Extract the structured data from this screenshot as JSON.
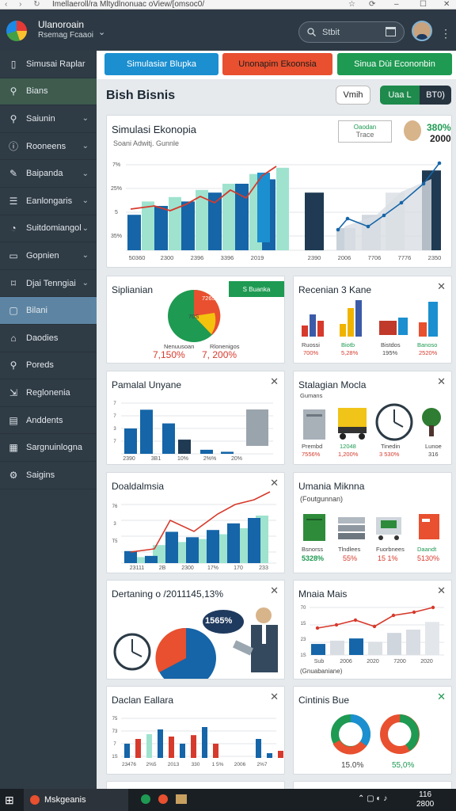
{
  "browser": {
    "url": "Imellaeroll/ra Mltydlnonuac oView/[omsoc0/",
    "nav": "‹ › ↻"
  },
  "app": {
    "name": "Ulanoroain",
    "subtitle": "Rsemag Fcaaoi"
  },
  "search": {
    "placeholder": "Stbit"
  },
  "sidebar": {
    "items": [
      {
        "label": "Simusai Raplar",
        "icon": "book-icon",
        "chev": false,
        "state": ""
      },
      {
        "label": "Bians",
        "icon": "search-icon",
        "chev": false,
        "state": "green"
      },
      {
        "label": "Saiunin",
        "icon": "search-icon",
        "chev": true,
        "state": ""
      },
      {
        "label": "Rooneens",
        "icon": "info-icon",
        "chev": true,
        "state": ""
      },
      {
        "label": "Baipanda",
        "icon": "edit-icon",
        "chev": true,
        "state": ""
      },
      {
        "label": "Eanlongaris",
        "icon": "list-icon",
        "chev": true,
        "state": ""
      },
      {
        "label": "Suitdomiangol",
        "icon": "gauge-icon",
        "chev": true,
        "state": ""
      },
      {
        "label": "Gopnien",
        "icon": "window-icon",
        "chev": true,
        "state": ""
      },
      {
        "label": "Djai Tenngiai",
        "icon": "tag-icon",
        "chev": true,
        "state": ""
      },
      {
        "label": "Bilani",
        "icon": "chat-icon",
        "chev": false,
        "state": "active"
      },
      {
        "label": "Daodies",
        "icon": "home-icon",
        "chev": false,
        "state": ""
      },
      {
        "label": "Poreds",
        "icon": "search-icon",
        "chev": false,
        "state": ""
      },
      {
        "label": "Reglonenia",
        "icon": "export-icon",
        "chev": false,
        "state": ""
      },
      {
        "label": "Anddents",
        "icon": "doc-icon",
        "chev": false,
        "state": ""
      },
      {
        "label": "Sargnuinlogna",
        "icon": "calendar-icon",
        "chev": false,
        "state": ""
      },
      {
        "label": "Saigins",
        "icon": "gear-icon",
        "chev": false,
        "state": ""
      }
    ]
  },
  "tabs": [
    {
      "label": "Simulasiar Blupka",
      "color": "#1b8fd0"
    },
    {
      "label": "Unonapim Ekoonsia",
      "color": "#e8502f"
    },
    {
      "label": "Sinua Dùi Econonbin",
      "color": "#1e9a52"
    }
  ],
  "page": {
    "title": "Bish Bisnis",
    "view_btn": "Vmih",
    "seg_a": "Uaa L",
    "seg_b": "BT0)"
  },
  "hero": {
    "title": "Simulasi Ekonopia",
    "subtitle": "Soani Adwitj. Gunnle",
    "badge_line1": "Oaodan",
    "badge_line2": "Trace",
    "stat_top": "380%",
    "stat_bottom": "2000",
    "x_left": [
      "50360",
      "2300",
      "2396",
      "3396",
      "2019"
    ],
    "x_right": [
      "2390",
      "2006",
      "7706",
      "7776",
      "2350"
    ],
    "y_ticks": [
      "7%",
      "25%",
      "5",
      "35%"
    ]
  },
  "cards": {
    "c1": {
      "title": "Siplianian",
      "badge": "S Buanka",
      "pie_top": "7265",
      "pie_mid": "70S",
      "l1": "Nenuusoan",
      "l2": "Rlonenigos",
      "v1": "7,150%",
      "v2": "7, 200%"
    },
    "c2": {
      "title": "Recenian 3 Kane",
      "items": [
        {
          "n": "Ruossi",
          "p": "700%"
        },
        {
          "n": "Biotb",
          "p": "5,28%"
        },
        {
          "n": "Bistdos",
          "p": "195%"
        },
        {
          "n": "Banoso",
          "p": "2520%"
        }
      ]
    },
    "c3": {
      "title": "Pamalal Unyane",
      "x": [
        "2390",
        "3B1",
        "10%",
        "2%%",
        "20%"
      ]
    },
    "c4": {
      "title": "Stalagian Mocla",
      "sub": "Gumans",
      "items": [
        {
          "n": "Prembd",
          "p": "7556%"
        },
        {
          "n": "12048",
          "p": "1,200%"
        },
        {
          "n": "Tinedin",
          "p": "3 530%"
        },
        {
          "n": "Lunoe",
          "p": "316"
        }
      ]
    },
    "c5": {
      "title": "Doaldalmsia",
      "x": [
        "23111",
        "2B",
        "2300",
        "17%",
        "170",
        "233"
      ]
    },
    "c6": {
      "title": "Umania Miknna",
      "sub": "(Foutgunnan)",
      "items": [
        {
          "n": "Bsnorss",
          "p": "5328%"
        },
        {
          "n": "Tlndlees",
          "p": "55%"
        },
        {
          "n": "Fuorbnees",
          "p": "15 1%"
        },
        {
          "n": "Daandt",
          "p": "5130%"
        }
      ]
    },
    "c7": {
      "title": "Dertaning o /2011145,13%",
      "bubble": "1565%"
    },
    "c8": {
      "title": "Mnaia Mais",
      "x": [
        "Sub",
        "2006",
        "2020",
        "7200",
        "2020"
      ],
      "y": [
        "70",
        "15",
        "23",
        "1S"
      ],
      "foot": "(Gnuabaniane)"
    },
    "c9": {
      "title": "Daclan Eallara",
      "x": [
        "23476",
        "2%5",
        "2013",
        "330",
        "1 5%",
        "2006",
        "2%7"
      ]
    },
    "c10": {
      "title": "Cintinis Bue",
      "v1": "15.0%",
      "v2": "55,0%"
    }
  },
  "taskbar": {
    "label": "Mskgeanis",
    "time": "116",
    "date": "2800"
  },
  "chart_data": [
    {
      "type": "bar",
      "title": "Simulasi Ekonopia",
      "categories": [
        "50360",
        "2300",
        "2396",
        "3396",
        "2019"
      ],
      "series": [
        {
          "values": [
            4,
            5,
            5.5,
            6.5,
            7.5,
            8
          ]
        },
        {
          "values": [
            5.5,
            6,
            6.8,
            7.5,
            8.6,
            9.3
          ]
        }
      ]
    },
    {
      "type": "bar",
      "categories": [
        "2390",
        "2006",
        "7706",
        "7776",
        "2350"
      ],
      "series": [
        {
          "values": [
            6.5,
            2.5,
            4,
            6.5,
            9
          ]
        }
      ]
    },
    {
      "type": "bar",
      "title": "Pamalal Unyane",
      "categories": [
        "2390",
        "3B1",
        "10%",
        "2%%",
        "20%"
      ],
      "series": [
        {
          "values": [
            5,
            8.7,
            6,
            2.8,
            0.8,
            0.4
          ]
        }
      ]
    },
    {
      "type": "bar",
      "title": "Doaldalmsia",
      "categories": [
        "23111",
        "2B",
        "2300",
        "17%",
        "170",
        "233"
      ],
      "series": [
        {
          "values": [
            2,
            1.2,
            5.2,
            4.3,
            5.5,
            6.6,
            7.5
          ]
        },
        {
          "values": [
            1,
            3,
            3.5,
            4,
            4.8,
            5.8,
            7.9
          ]
        }
      ]
    },
    {
      "type": "bar",
      "title": "Mnaia Mais",
      "categories": [
        "Sub",
        "2006",
        "2020",
        "7200",
        "2020"
      ],
      "series": [
        {
          "values": [
            2,
            2.6,
            3,
            2.4,
            4,
            4.6,
            6
          ]
        }
      ]
    },
    {
      "type": "bar",
      "title": "Daclan Eallara",
      "categories": [
        "23476",
        "2%5",
        "2013",
        "330",
        "1 5%",
        "2006",
        "2%7"
      ],
      "series": [
        {
          "values": [
            3,
            4,
            5,
            6,
            4.5,
            3,
            4.8,
            6.5,
            3,
            4,
            1,
            1.5,
            1
          ]
        }
      ]
    },
    {
      "type": "pie",
      "title": "Siplianian",
      "values": [
        60,
        40
      ]
    },
    {
      "type": "pie",
      "title": "Cintinis Bue",
      "values": [
        15,
        55
      ]
    }
  ]
}
